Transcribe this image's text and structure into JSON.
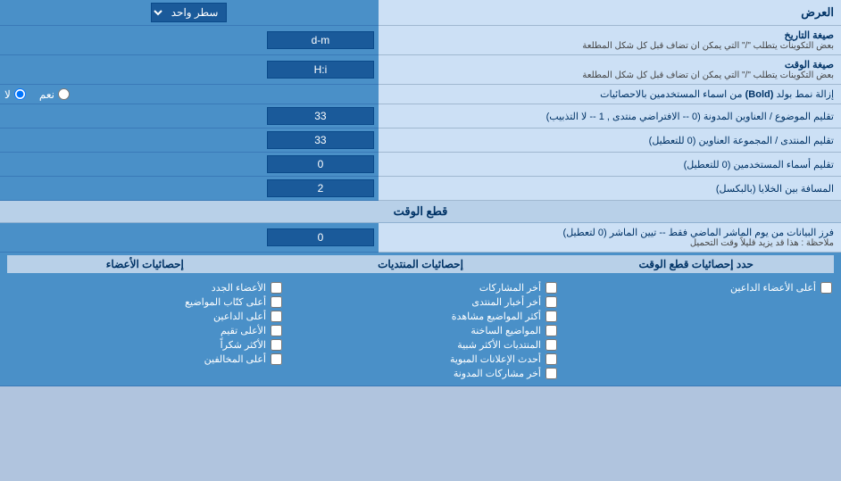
{
  "header": {
    "title": "العرض",
    "display_mode_label": "سطر واحد"
  },
  "rows": [
    {
      "label": "صيغة التاريخ\nبعض التكوينات يتطلب \"/\" التي يمكن ان تضاف قبل كل شكل المطلعة",
      "input_value": "d-m",
      "type": "text"
    },
    {
      "label": "صيغة الوقت\nبعض التكوينات يتطلب \"/\" التي يمكن ان تضاف قبل كل شكل المطلعة",
      "input_value": "H:i",
      "type": "text"
    },
    {
      "label": "إزالة نمط بولد (Bold) من اسماء المستخدمين بالاحصائيات",
      "type": "radio",
      "options": [
        "نعم",
        "لا"
      ],
      "selected": "لا"
    },
    {
      "label": "تقليم الموضوع / العناوين المدونة (0 -- الافتراضي منتدى , 1 -- لا التذبيب)",
      "input_value": "33",
      "type": "text"
    },
    {
      "label": "تقليم المنتدى / المجموعة العناوين (0 للتعطيل)",
      "input_value": "33",
      "type": "text"
    },
    {
      "label": "تقليم أسماء المستخدمين (0 للتعطيل)",
      "input_value": "0",
      "type": "text"
    },
    {
      "label": "المسافة بين الخلايا (بالبكسل)",
      "input_value": "2",
      "type": "text"
    }
  ],
  "section_cut": {
    "title": "قطع الوقت",
    "row_label": "فرز البيانات من يوم الماشر الماضي فقط -- تيين الماشر (0 لتعطيل)\nملاحظة : هذا قد يزيد قليلاً وقت التحميل",
    "input_value": "0",
    "stats_label": "حدد إحصائيات قطع الوقت"
  },
  "checkboxes": {
    "col1_header": "إحصائيات الأعضاء",
    "col2_header": "إحصائيات المنتديات",
    "col3_header": "",
    "col1_items": [
      "الأعضاء الجدد",
      "أعلى كتّاب المواضيع",
      "أعلى الداعين",
      "الأعلى تقيم",
      "الأكثر شكراً",
      "أعلى المخالفين"
    ],
    "col2_items": [
      "أخر المشاركات",
      "أخر أخبار المنتدى",
      "أكثر المواضيع مشاهدة",
      "المواضيع الساخنة",
      "المنتديات الأكثر شبية",
      "أحدث الإعلانات المبوية",
      "أخر مشاركات المدونة"
    ],
    "col3_items": [
      "أعلى الأعضاء الداعين"
    ]
  }
}
